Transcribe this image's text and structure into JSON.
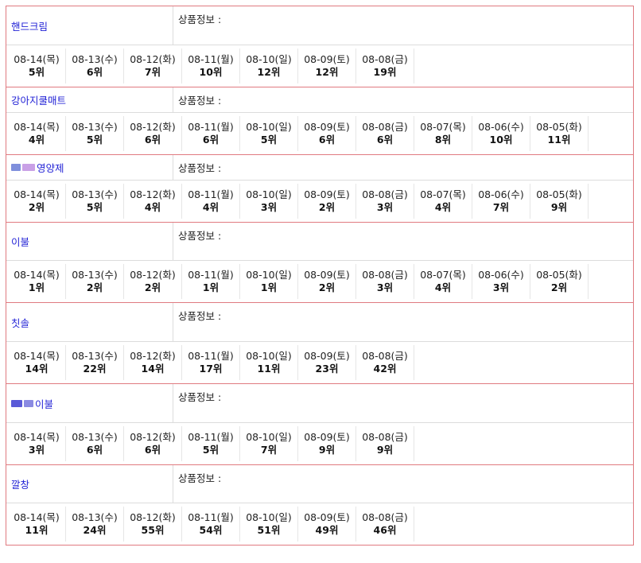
{
  "info_label": "상품정보 :",
  "products": [
    {
      "keyword": "핸드크림",
      "keyword_mask": [],
      "ranks": [
        {
          "date": "08-14(목)",
          "rank": "5위"
        },
        {
          "date": "08-13(수)",
          "rank": "6위"
        },
        {
          "date": "08-12(화)",
          "rank": "7위"
        },
        {
          "date": "08-11(월)",
          "rank": "10위"
        },
        {
          "date": "08-10(일)",
          "rank": "12위"
        },
        {
          "date": "08-09(토)",
          "rank": "12위"
        },
        {
          "date": "08-08(금)",
          "rank": "19위"
        }
      ]
    },
    {
      "keyword": "강아지쿨매트",
      "keyword_mask": [],
      "ranks": [
        {
          "date": "08-14(목)",
          "rank": "4위"
        },
        {
          "date": "08-13(수)",
          "rank": "5위"
        },
        {
          "date": "08-12(화)",
          "rank": "6위"
        },
        {
          "date": "08-11(월)",
          "rank": "6위"
        },
        {
          "date": "08-10(일)",
          "rank": "5위"
        },
        {
          "date": "08-09(토)",
          "rank": "6위"
        },
        {
          "date": "08-08(금)",
          "rank": "6위"
        },
        {
          "date": "08-07(목)",
          "rank": "8위"
        },
        {
          "date": "08-06(수)",
          "rank": "10위"
        },
        {
          "date": "08-05(화)",
          "rank": "11위"
        }
      ]
    },
    {
      "keyword": "영양제",
      "keyword_mask": [
        "#7f8fdc",
        "#c9a0e6"
      ],
      "ranks": [
        {
          "date": "08-14(목)",
          "rank": "2위"
        },
        {
          "date": "08-13(수)",
          "rank": "5위"
        },
        {
          "date": "08-12(화)",
          "rank": "4위"
        },
        {
          "date": "08-11(월)",
          "rank": "4위"
        },
        {
          "date": "08-10(일)",
          "rank": "3위"
        },
        {
          "date": "08-09(토)",
          "rank": "2위"
        },
        {
          "date": "08-08(금)",
          "rank": "3위"
        },
        {
          "date": "08-07(목)",
          "rank": "4위"
        },
        {
          "date": "08-06(수)",
          "rank": "7위"
        },
        {
          "date": "08-05(화)",
          "rank": "9위"
        }
      ]
    },
    {
      "keyword": "이불",
      "keyword_mask": [],
      "ranks": [
        {
          "date": "08-14(목)",
          "rank": "1위"
        },
        {
          "date": "08-13(수)",
          "rank": "2위"
        },
        {
          "date": "08-12(화)",
          "rank": "2위"
        },
        {
          "date": "08-11(월)",
          "rank": "1위"
        },
        {
          "date": "08-10(일)",
          "rank": "1위"
        },
        {
          "date": "08-09(토)",
          "rank": "2위"
        },
        {
          "date": "08-08(금)",
          "rank": "3위"
        },
        {
          "date": "08-07(목)",
          "rank": "4위"
        },
        {
          "date": "08-06(수)",
          "rank": "3위"
        },
        {
          "date": "08-05(화)",
          "rank": "2위"
        }
      ]
    },
    {
      "keyword": "칫솔",
      "keyword_mask": [],
      "ranks": [
        {
          "date": "08-14(목)",
          "rank": "14위"
        },
        {
          "date": "08-13(수)",
          "rank": "22위"
        },
        {
          "date": "08-12(화)",
          "rank": "14위"
        },
        {
          "date": "08-11(월)",
          "rank": "17위"
        },
        {
          "date": "08-10(일)",
          "rank": "11위"
        },
        {
          "date": "08-09(토)",
          "rank": "23위"
        },
        {
          "date": "08-08(금)",
          "rank": "42위"
        }
      ]
    },
    {
      "keyword": "이불",
      "keyword_mask": [
        "#5a5ad8",
        "#8a8ae2"
      ],
      "ranks": [
        {
          "date": "08-14(목)",
          "rank": "3위"
        },
        {
          "date": "08-13(수)",
          "rank": "6위"
        },
        {
          "date": "08-12(화)",
          "rank": "6위"
        },
        {
          "date": "08-11(월)",
          "rank": "5위"
        },
        {
          "date": "08-10(일)",
          "rank": "7위"
        },
        {
          "date": "08-09(토)",
          "rank": "9위"
        },
        {
          "date": "08-08(금)",
          "rank": "9위"
        }
      ]
    },
    {
      "keyword": "깔창",
      "keyword_mask": [],
      "ranks": [
        {
          "date": "08-14(목)",
          "rank": "11위"
        },
        {
          "date": "08-13(수)",
          "rank": "24위"
        },
        {
          "date": "08-12(화)",
          "rank": "55위"
        },
        {
          "date": "08-11(월)",
          "rank": "54위"
        },
        {
          "date": "08-10(일)",
          "rank": "51위"
        },
        {
          "date": "08-09(토)",
          "rank": "49위"
        },
        {
          "date": "08-08(금)",
          "rank": "46위"
        }
      ]
    }
  ]
}
